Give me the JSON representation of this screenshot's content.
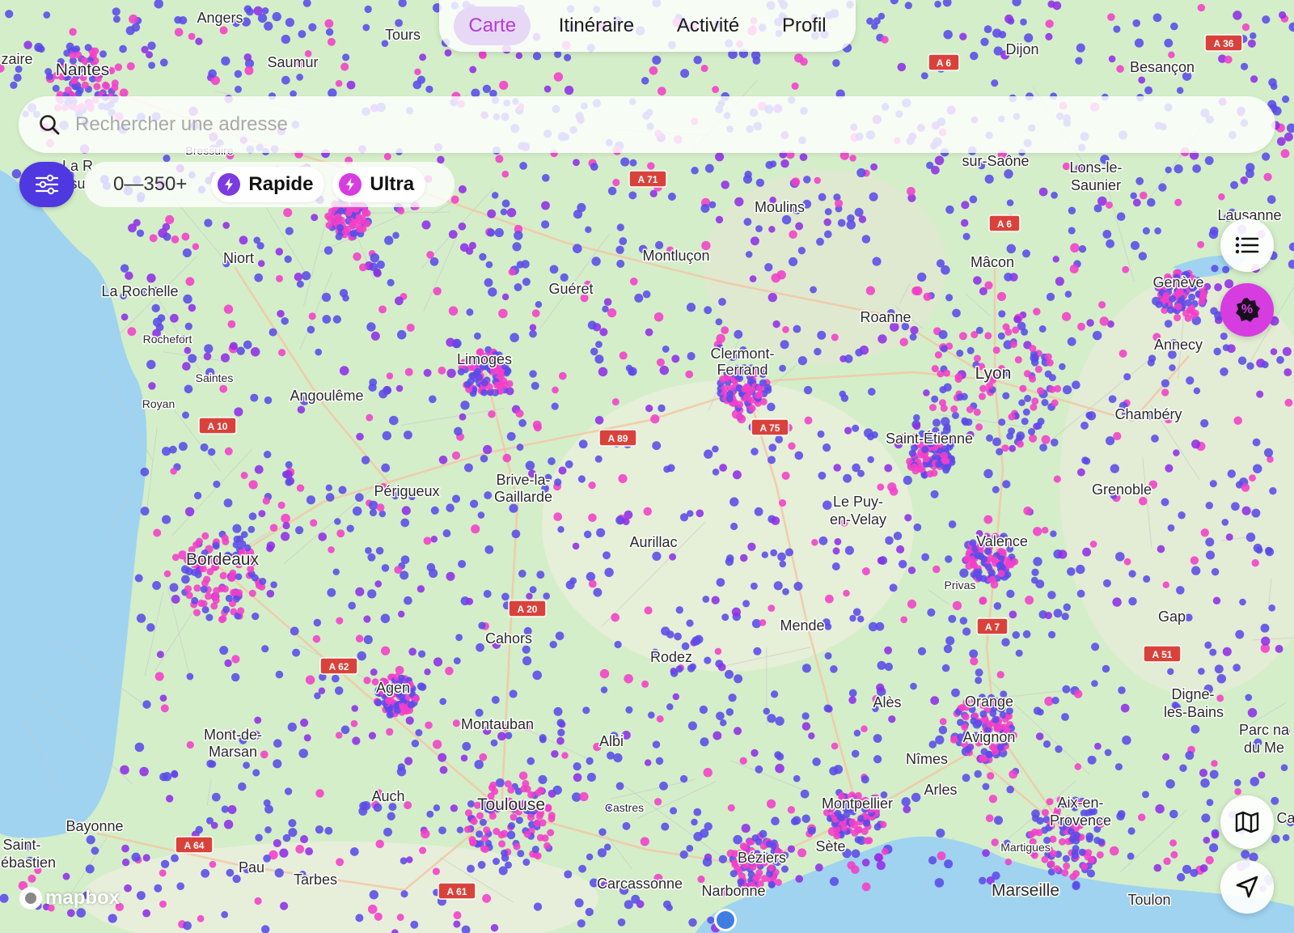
{
  "app": {
    "nav": {
      "tabs": [
        "Carte",
        "Itinéraire",
        "Activité",
        "Profil"
      ],
      "active": 0
    },
    "search": {
      "placeholder": "Rechercher une adresse",
      "value": ""
    },
    "filters": {
      "power_range": "0—350+",
      "chips": [
        {
          "label": "Rapide",
          "color": "#7b3be0"
        },
        {
          "label": "Ultra",
          "color": "#d63ce0"
        }
      ]
    },
    "promo_badge": "%",
    "attribution": "mapbox"
  },
  "map": {
    "colors": {
      "land": "#d4eec9",
      "land_alt": "#e8f0d6",
      "sea": "#9fd3f0",
      "road": "#f3c6a5",
      "station_blue": "#5a4be8",
      "station_purple": "#8f2fe6",
      "station_pink": "#f23fc8",
      "location": "#3f7de0"
    },
    "places": [
      {
        "name": "Angers",
        "size": "s"
      },
      {
        "name": "Tours",
        "size": "s"
      },
      {
        "name": "zaire",
        "size": "s"
      },
      {
        "name": "Nantes",
        "size": "m"
      },
      {
        "name": "Saumur",
        "size": "s"
      },
      {
        "name": "Dijon",
        "size": "s"
      },
      {
        "name": "Besançon",
        "size": "s"
      },
      {
        "name": "La R",
        "size": "s"
      },
      {
        "name": "su",
        "size": "s"
      },
      {
        "name": "Bressuire",
        "size": "xs"
      },
      {
        "name": "sur-Saône",
        "size": "s"
      },
      {
        "name": "Lons-le-",
        "size": "s"
      },
      {
        "name": "Saunier",
        "size": "s"
      },
      {
        "name": "Moulins",
        "size": "s"
      },
      {
        "name": "Lausanne",
        "size": "s"
      },
      {
        "name": "Niort",
        "size": "s"
      },
      {
        "name": "Montluçon",
        "size": "s"
      },
      {
        "name": "Mâcon",
        "size": "s"
      },
      {
        "name": "La Rochelle",
        "size": "s"
      },
      {
        "name": "Guéret",
        "size": "s"
      },
      {
        "name": "Genève",
        "size": "s"
      },
      {
        "name": "Roanne",
        "size": "s"
      },
      {
        "name": "Rochefort",
        "size": "xs"
      },
      {
        "name": "Annecy",
        "size": "s"
      },
      {
        "name": "Limoges",
        "size": "s"
      },
      {
        "name": "Clermont-",
        "size": "s"
      },
      {
        "name": "Ferrand",
        "size": "s"
      },
      {
        "name": "Lyon",
        "size": "m"
      },
      {
        "name": "Saintes",
        "size": "xs"
      },
      {
        "name": "Angoulême",
        "size": "s"
      },
      {
        "name": "Royan",
        "size": "xs"
      },
      {
        "name": "Chambéry",
        "size": "s"
      },
      {
        "name": "Saint-Étienne",
        "size": "s"
      },
      {
        "name": "Brive-la-",
        "size": "s"
      },
      {
        "name": "Gaillarde",
        "size": "s"
      },
      {
        "name": "Périgueux",
        "size": "s"
      },
      {
        "name": "Grenoble",
        "size": "s"
      },
      {
        "name": "Le Puy-",
        "size": "s"
      },
      {
        "name": "en-Velay",
        "size": "s"
      },
      {
        "name": "Aurillac",
        "size": "s"
      },
      {
        "name": "Valence",
        "size": "s"
      },
      {
        "name": "Bordeaux",
        "size": "m"
      },
      {
        "name": "Privas",
        "size": "xs"
      },
      {
        "name": "Gap",
        "size": "s"
      },
      {
        "name": "Mende",
        "size": "s"
      },
      {
        "name": "Cahors",
        "size": "s"
      },
      {
        "name": "Rodez",
        "size": "s"
      },
      {
        "name": "Agen",
        "size": "s"
      },
      {
        "name": "Digne-",
        "size": "s"
      },
      {
        "name": "les-Bains",
        "size": "s"
      },
      {
        "name": "Alès",
        "size": "s"
      },
      {
        "name": "Orange",
        "size": "s"
      },
      {
        "name": "Montauban",
        "size": "s"
      },
      {
        "name": "Mont-de-",
        "size": "s"
      },
      {
        "name": "Marsan",
        "size": "s"
      },
      {
        "name": "Avignon",
        "size": "s"
      },
      {
        "name": "Albi",
        "size": "s"
      },
      {
        "name": "Nîmes",
        "size": "s"
      },
      {
        "name": "Parc na",
        "size": "s"
      },
      {
        "name": "du Me",
        "size": "s"
      },
      {
        "name": "Auch",
        "size": "s"
      },
      {
        "name": "Castres",
        "size": "xs"
      },
      {
        "name": "Arles",
        "size": "s"
      },
      {
        "name": "Toulouse",
        "size": "m"
      },
      {
        "name": "Montpellier",
        "size": "s"
      },
      {
        "name": "Aix-en-",
        "size": "s"
      },
      {
        "name": "Provence",
        "size": "s"
      },
      {
        "name": "Bayonne",
        "size": "s"
      },
      {
        "name": "Ca",
        "size": "s"
      },
      {
        "name": "Saint-",
        "size": "s"
      },
      {
        "name": "ébastien",
        "size": "s"
      },
      {
        "name": "Sète",
        "size": "s"
      },
      {
        "name": "Martigues",
        "size": "xs"
      },
      {
        "name": "Pau",
        "size": "s"
      },
      {
        "name": "Béziers",
        "size": "s"
      },
      {
        "name": "Tarbes",
        "size": "s"
      },
      {
        "name": "Carcassonne",
        "size": "s"
      },
      {
        "name": "Narbonne",
        "size": "s"
      },
      {
        "name": "Marseille",
        "size": "m"
      },
      {
        "name": "Toulon",
        "size": "s"
      }
    ],
    "highway_shields": [
      "A 36",
      "A 6",
      "A 71",
      "A 6",
      "A 10",
      "A 89",
      "A 75",
      "A 20",
      "A 62",
      "A 7",
      "A 51",
      "A 64",
      "A 61"
    ]
  }
}
